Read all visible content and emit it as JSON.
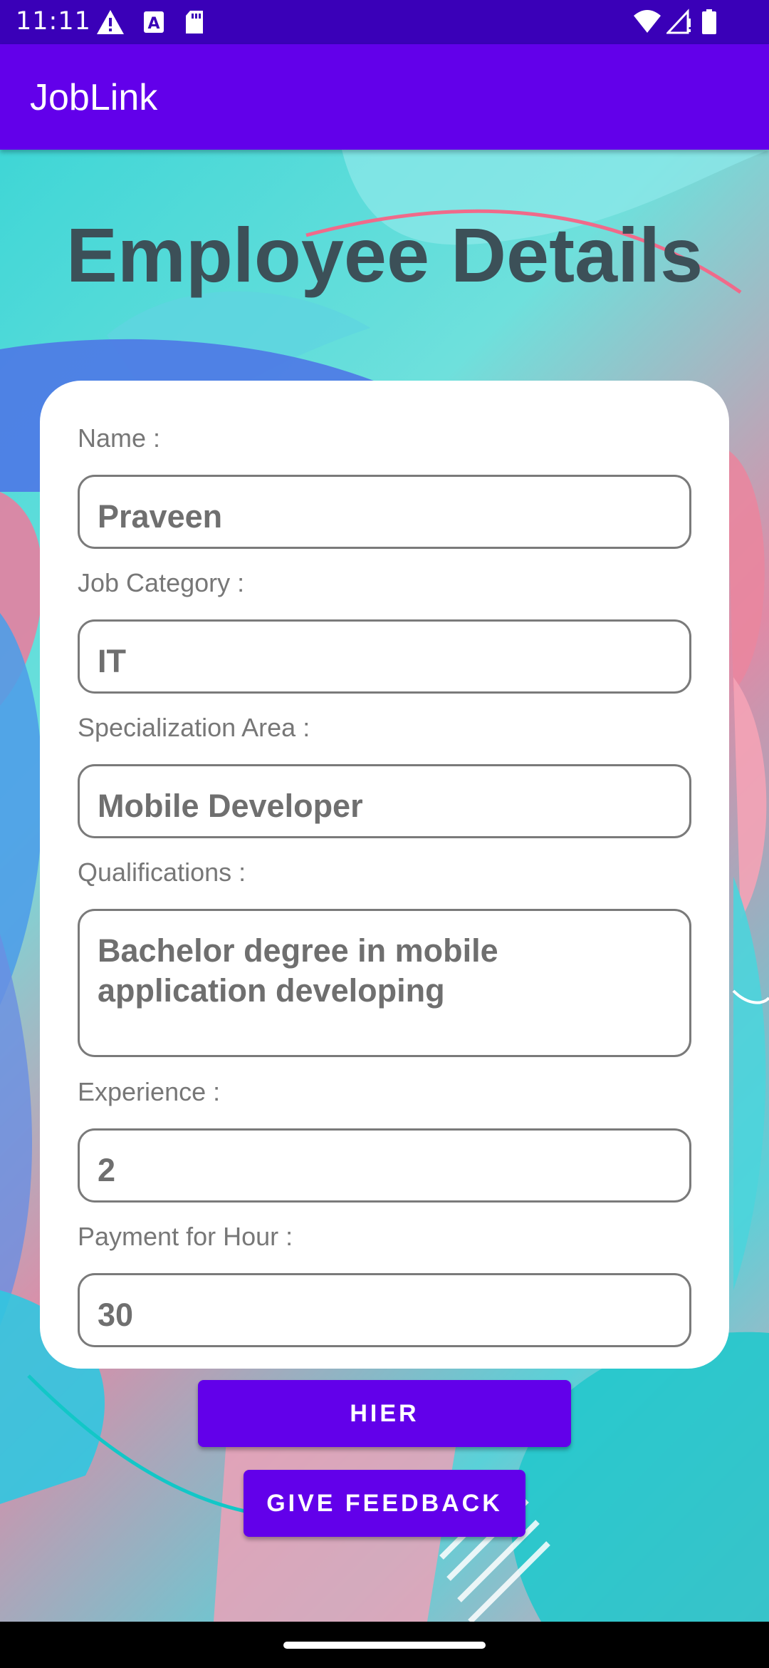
{
  "status_bar": {
    "time": "11:11",
    "icons": [
      "warning-icon",
      "text-a-icon",
      "sd-card-icon",
      "wifi-icon",
      "signal-icon",
      "battery-icon"
    ]
  },
  "app_bar": {
    "title": "JobLink"
  },
  "page": {
    "title": "Employee Details"
  },
  "form": {
    "name_label": "Name :",
    "name_value": "Praveen",
    "category_label": "Job Category :",
    "category_value": "IT",
    "specialization_label": "Specialization Area :",
    "specialization_value": "Mobile Developer",
    "qualifications_label": "Qualifications :",
    "qualifications_value": "Bachelor degree in mobile application developing",
    "experience_label": "Experience :",
    "experience_value": "2",
    "payment_label": "Payment for Hour :",
    "payment_value": "30"
  },
  "actions": {
    "hire_label": "HIER",
    "feedback_label": "GIVE FEEDBACK"
  },
  "colors": {
    "primary": "#6200ea",
    "status_bar": "#3a00b8",
    "title_text": "#3c5058"
  }
}
